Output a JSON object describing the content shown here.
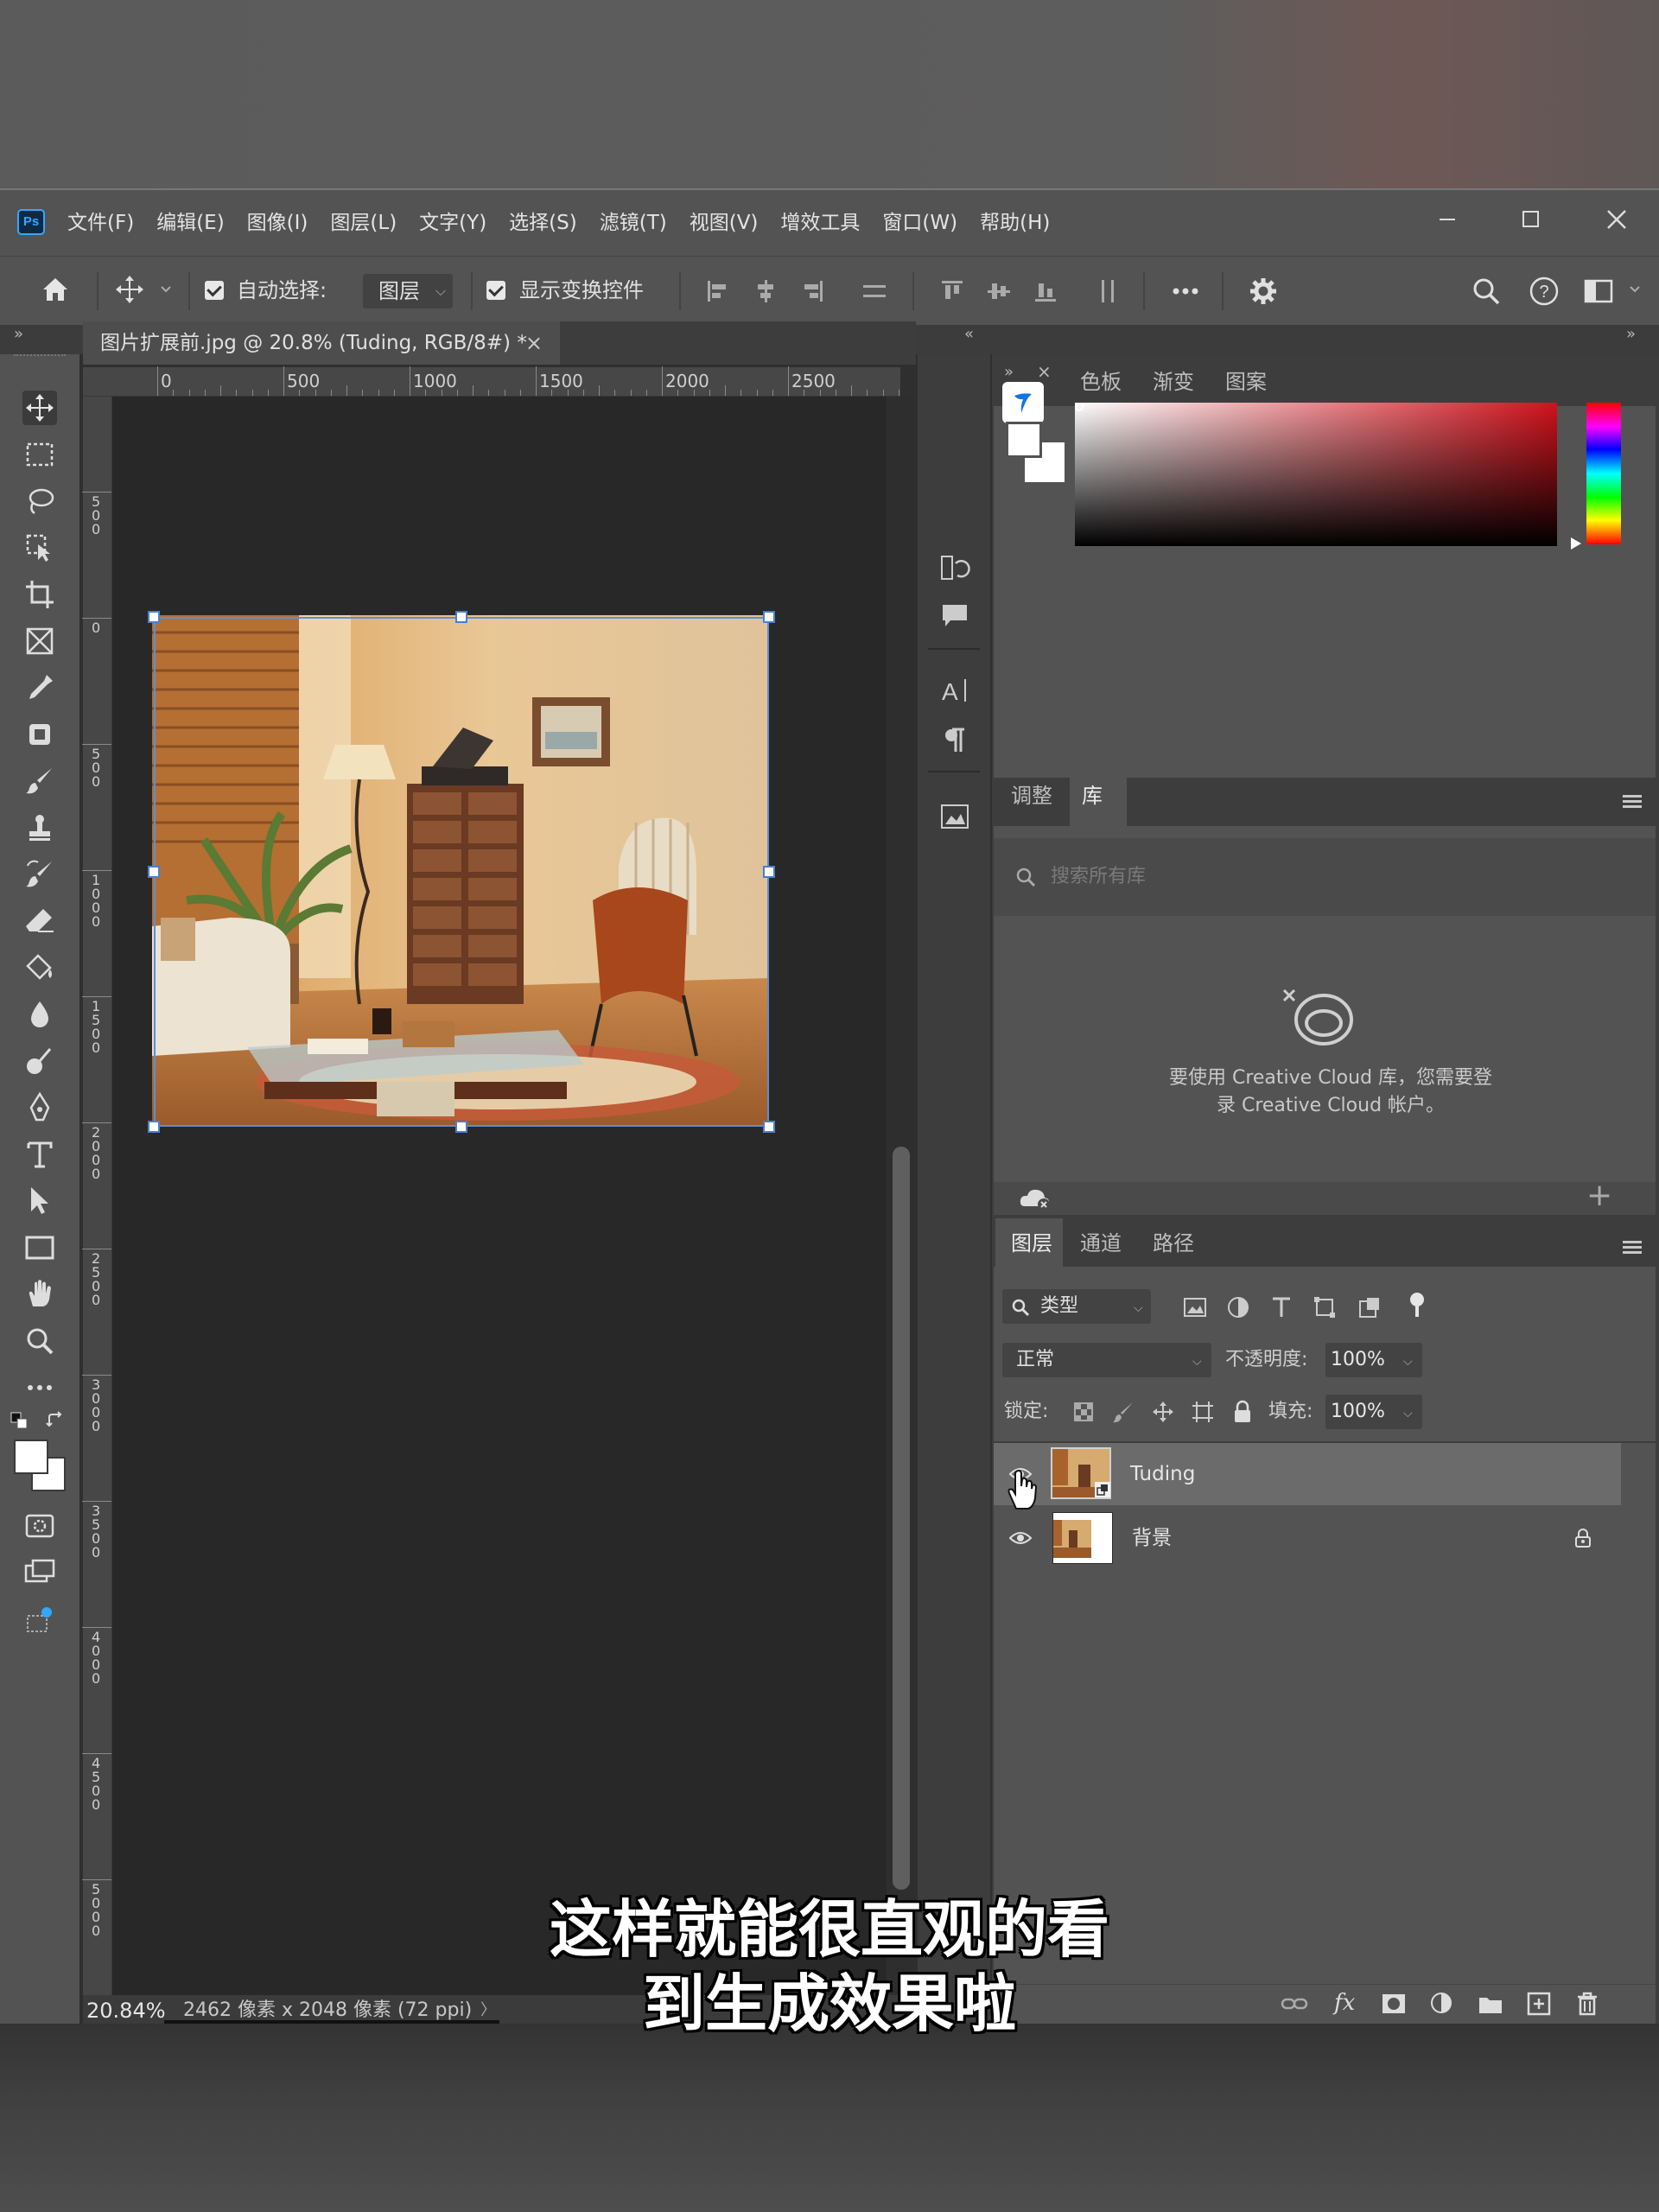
{
  "app": {
    "logo_text": "Ps",
    "menu": [
      "文件(F)",
      "编辑(E)",
      "图像(I)",
      "图层(L)",
      "文字(Y)",
      "选择(S)",
      "滤镜(T)",
      "视图(V)",
      "增效工具",
      "窗口(W)",
      "帮助(H)"
    ]
  },
  "options": {
    "auto_select_label": "自动选择:",
    "auto_select_value": "图层",
    "show_transform_label": "显示变换控件",
    "auto_select_checked": true,
    "show_transform_checked": true
  },
  "document": {
    "tab_title": "图片扩展前.jpg @ 20.8% (Tuding, RGB/8#) *",
    "tab_close": "×",
    "ruler_labels": [
      "0",
      "500",
      "1000",
      "1500",
      "2000",
      "2500"
    ],
    "vruler_labels": [
      "500",
      "0",
      "500",
      "1000",
      "1500",
      "2000",
      "2500",
      "3000",
      "3500",
      "4000",
      "4500",
      "5000"
    ]
  },
  "status": {
    "zoom": "20.84%",
    "info": "2462 像素 x 2048 像素 (72 ppi)",
    "more_arrow": "〉"
  },
  "color_panel": {
    "tabs": [
      "色板",
      "渐变",
      "图案"
    ],
    "accent": "#d0121c"
  },
  "library_panel": {
    "tabs": [
      "调整",
      "库"
    ],
    "active_tab": "库",
    "search_placeholder": "搜索所有库",
    "message_line1": "要使用 Creative Cloud 库，您需要登",
    "message_line2": "录 Creative Cloud 帐户。",
    "add_symbol": "+"
  },
  "layers_panel": {
    "tabs": [
      "图层",
      "通道",
      "路径"
    ],
    "filter_label": "类型",
    "blend_mode": "正常",
    "opacity_label": "不透明度:",
    "opacity_value": "100%",
    "lock_label": "锁定:",
    "fill_label": "填充:",
    "fill_value": "100%",
    "layers": [
      {
        "name": "Tuding",
        "selected": true,
        "visible": true,
        "locked": false
      },
      {
        "name": "背景",
        "selected": false,
        "visible": true,
        "locked": true
      }
    ],
    "footer_fx": "fx"
  },
  "subtitle": {
    "line1": "这样就能很直观的看",
    "line2": "到生成效果啦"
  }
}
